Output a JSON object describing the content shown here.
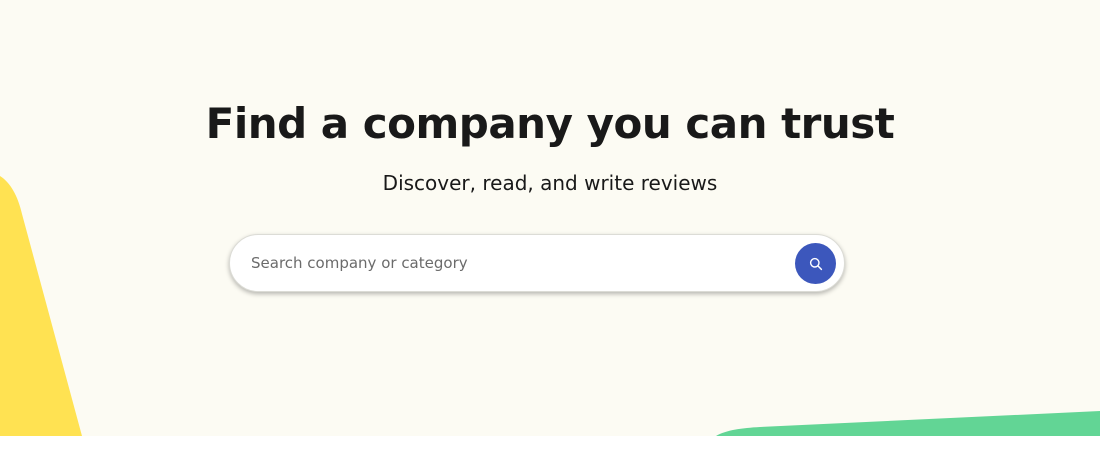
{
  "hero": {
    "title": "Find a company you can trust",
    "subtitle": "Discover, read, and write reviews"
  },
  "search": {
    "placeholder": "Search company or category",
    "value": "",
    "button_icon": "search-icon"
  },
  "colors": {
    "background": "#fcfbf3",
    "accent_yellow": "#ffe252",
    "accent_green": "#62d595",
    "search_button": "#3c57bc",
    "text": "#191919"
  }
}
